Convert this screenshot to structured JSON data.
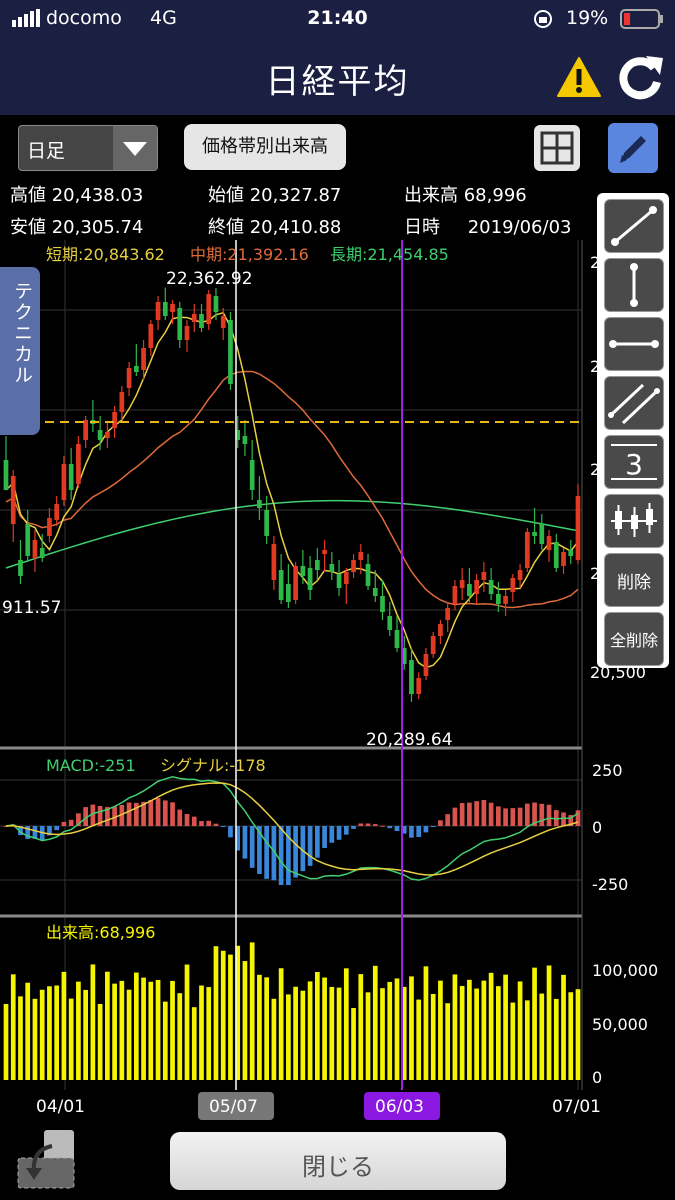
{
  "status": {
    "carrier": "docomo",
    "network": "4G",
    "time": "21:40",
    "battery": "19%",
    "battery_level": 0.19
  },
  "header": {
    "title": "日経平均",
    "warning_icon": "warning-triangle-icon",
    "refresh_icon": "refresh-icon"
  },
  "controls": {
    "period_select": "日足",
    "volume_profile_button": "価格帯別出来高"
  },
  "ohlc": {
    "high_label": "高値",
    "high": "20,438.03",
    "open_label": "始値",
    "open": "20,327.87",
    "volume_label": "出来高",
    "volume": "68,996",
    "low_label": "安値",
    "low": "20,305.74",
    "close_label": "終値",
    "close": "20,410.88",
    "date_label": "日時",
    "date": "2019/06/03"
  },
  "side_tab": {
    "label": "テクニカル"
  },
  "tools": {
    "delete": "削除",
    "delete_all": "全削除",
    "fib_label": "3"
  },
  "chart_data": {
    "type": "candlestick",
    "ma_labels": {
      "short": "短期:20,843.62",
      "mid": "中期:21,392.16",
      "long": "長期:21,454.85"
    },
    "annotations": {
      "high": "22,362.92",
      "low_left": "911.57",
      "low": "20,289.64"
    },
    "price_axis_ticks": [
      "2",
      "2",
      "2",
      "2",
      "20,500"
    ],
    "macd": {
      "label": "MACD:-251",
      "signal_label": "シグナル:-178",
      "ticks": [
        "250",
        "0",
        "-250"
      ]
    },
    "volume": {
      "label": "出来高:68,996",
      "ticks": [
        "100,000",
        "50,000",
        "0"
      ]
    },
    "x_labels": [
      "04/01",
      "05/07",
      "06/03",
      "07/01"
    ],
    "candles": [
      [
        21500,
        21620,
        21400,
        21350
      ],
      [
        21180,
        21450,
        21090,
        21420
      ],
      [
        21000,
        21100,
        20880,
        20920
      ],
      [
        21180,
        21250,
        20990,
        21020
      ],
      [
        21010,
        21150,
        20940,
        21100
      ],
      [
        21060,
        21130,
        20990,
        21010
      ],
      [
        21120,
        21260,
        21090,
        21210
      ],
      [
        21200,
        21320,
        21170,
        21280
      ],
      [
        21300,
        21520,
        21270,
        21480
      ],
      [
        21480,
        21560,
        21300,
        21350
      ],
      [
        21380,
        21620,
        21360,
        21580
      ],
      [
        21600,
        21720,
        21560,
        21700
      ],
      [
        21700,
        21800,
        21640,
        21680
      ],
      [
        21650,
        21720,
        21550,
        21600
      ],
      [
        21610,
        21690,
        21560,
        21640
      ],
      [
        21660,
        21770,
        21610,
        21740
      ],
      [
        21740,
        21870,
        21700,
        21840
      ],
      [
        21860,
        21990,
        21820,
        21960
      ],
      [
        21970,
        22080,
        21920,
        21940
      ],
      [
        21950,
        22100,
        21900,
        22060
      ],
      [
        22060,
        22200,
        22020,
        22180
      ],
      [
        22200,
        22320,
        22150,
        22290
      ],
      [
        22290,
        22362,
        22200,
        22220
      ],
      [
        22240,
        22300,
        22180,
        22280
      ],
      [
        22260,
        22290,
        22060,
        22100
      ],
      [
        22100,
        22200,
        22040,
        22170
      ],
      [
        22190,
        22280,
        22140,
        22230
      ],
      [
        22230,
        22280,
        22140,
        22160
      ],
      [
        22180,
        22350,
        22150,
        22330
      ],
      [
        22320,
        22360,
        22200,
        22240
      ],
      [
        22160,
        22260,
        22100,
        22220
      ],
      [
        22200,
        22240,
        21850,
        21880
      ],
      [
        21650,
        21720,
        21560,
        21600
      ],
      [
        21620,
        21700,
        21520,
        21580
      ],
      [
        21500,
        21600,
        21300,
        21350
      ],
      [
        21300,
        21420,
        21200,
        21260
      ],
      [
        21250,
        21320,
        21080,
        21120
      ],
      [
        20900,
        21120,
        20850,
        21080
      ],
      [
        20950,
        21030,
        20780,
        20800
      ],
      [
        20880,
        20980,
        20760,
        20790
      ],
      [
        20800,
        20990,
        20780,
        20970
      ],
      [
        20970,
        21050,
        20880,
        20920
      ],
      [
        20960,
        21020,
        20800,
        20850
      ],
      [
        21000,
        21060,
        20900,
        20950
      ],
      [
        21030,
        21100,
        20940,
        21050
      ],
      [
        20980,
        21040,
        20900,
        20940
      ],
      [
        20930,
        21000,
        20820,
        20860
      ],
      [
        20880,
        20960,
        20780,
        20940
      ],
      [
        20940,
        21030,
        20910,
        21000
      ],
      [
        21000,
        21080,
        20930,
        21040
      ],
      [
        20980,
        21030,
        20850,
        20870
      ],
      [
        20860,
        20950,
        20790,
        20820
      ],
      [
        20820,
        20900,
        20700,
        20740
      ],
      [
        20720,
        20790,
        20620,
        20650
      ],
      [
        20650,
        20720,
        20540,
        20560
      ],
      [
        20560,
        20620,
        20450,
        20480
      ],
      [
        20500,
        20560,
        20290,
        20330
      ],
      [
        20330,
        20438,
        20305,
        20410
      ],
      [
        20420,
        20560,
        20400,
        20530
      ],
      [
        20530,
        20640,
        20510,
        20620
      ],
      [
        20620,
        20700,
        20580,
        20680
      ],
      [
        20700,
        20790,
        20640,
        20760
      ],
      [
        20780,
        20900,
        20750,
        20870
      ],
      [
        20860,
        20960,
        20800,
        20900
      ],
      [
        20880,
        20960,
        20790,
        20820
      ],
      [
        20830,
        20930,
        20780,
        20900
      ],
      [
        20900,
        20990,
        20840,
        20940
      ],
      [
        20900,
        20960,
        20800,
        20830
      ],
      [
        20830,
        20890,
        20740,
        20780
      ],
      [
        20780,
        20850,
        20720,
        20820
      ],
      [
        20840,
        20930,
        20790,
        20910
      ],
      [
        20900,
        20980,
        20860,
        20950
      ],
      [
        20960,
        21160,
        20940,
        21140
      ],
      [
        21140,
        21260,
        21080,
        21120
      ],
      [
        21180,
        21230,
        21050,
        21080
      ],
      [
        21050,
        21150,
        20990,
        21120
      ],
      [
        21090,
        21130,
        20940,
        20960
      ],
      [
        20970,
        21060,
        20930,
        21040
      ],
      [
        21050,
        21100,
        20980,
        21020
      ],
      [
        21000,
        21380,
        20980,
        21320
      ]
    ]
  }
}
